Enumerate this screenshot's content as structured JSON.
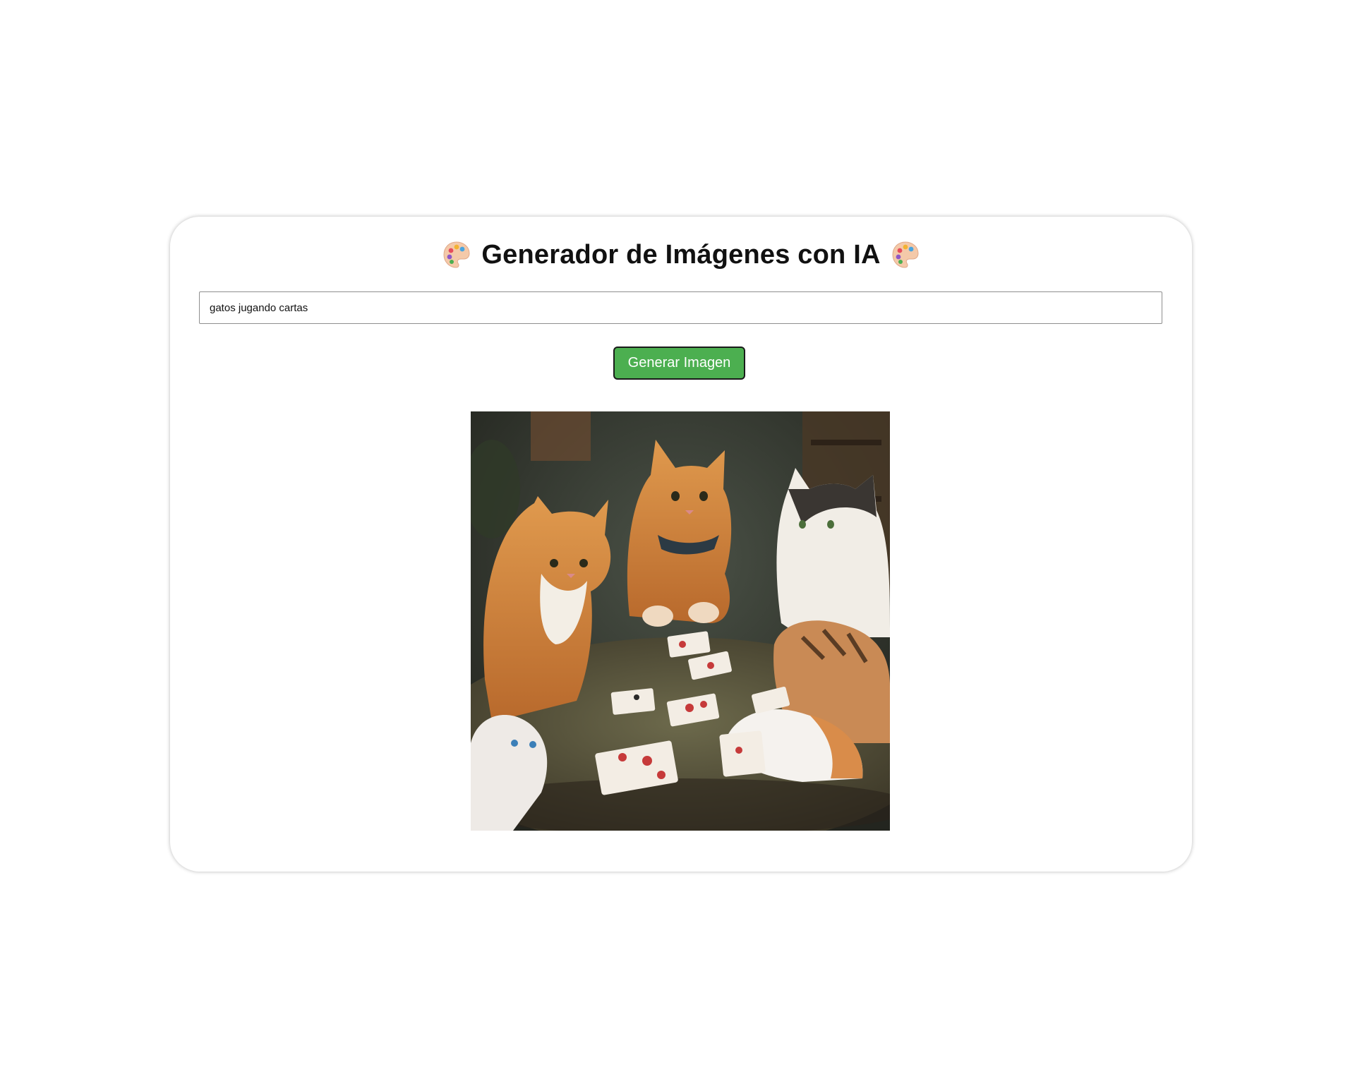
{
  "header": {
    "title": "Generador de Imágenes con IA",
    "left_icon": "palette-icon",
    "right_icon": "palette-icon"
  },
  "prompt": {
    "value": "gatos jugando cartas"
  },
  "actions": {
    "generate_label": "Generar Imagen",
    "generate_color": "#4caf50"
  },
  "result": {
    "image_description": "cats playing cards"
  }
}
